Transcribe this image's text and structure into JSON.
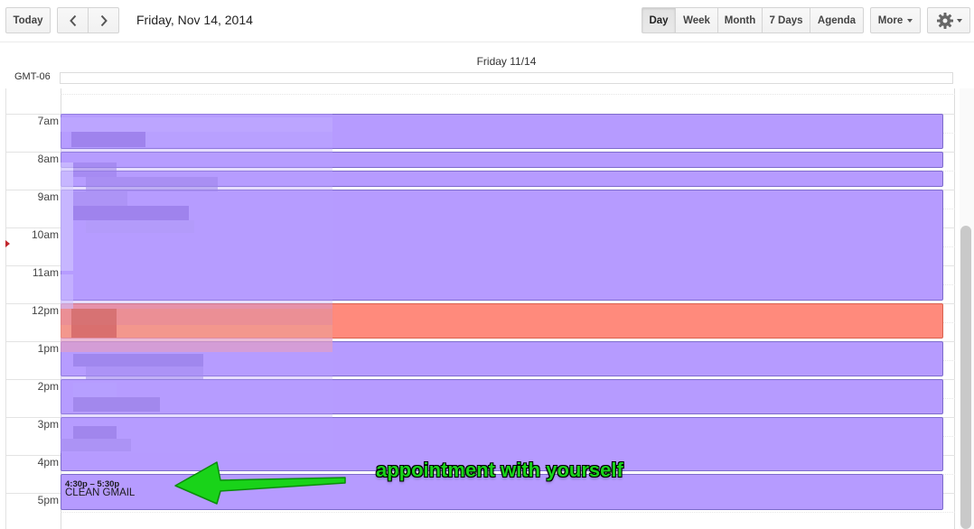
{
  "toolbar": {
    "today": "Today",
    "date_title": "Friday, Nov 14, 2014",
    "views": [
      "Day",
      "Week",
      "Month",
      "7 Days",
      "Agenda"
    ],
    "active_view": "Day",
    "more": "More",
    "icons": {
      "prev": "chevron-left-icon",
      "next": "chevron-right-icon",
      "settings": "gear-icon"
    }
  },
  "day_header": "Friday 11/14",
  "timezone": "GMT-06",
  "hours": [
    "7am",
    "8am",
    "9am",
    "10am",
    "11am",
    "12pm",
    "1pm",
    "2pm",
    "3pm",
    "4pm",
    "5pm"
  ],
  "events": [
    {
      "time": "4:30p – 5:30p",
      "title": "CLEAN GMAIL"
    }
  ],
  "annotation": "appointment with yourself",
  "colors": {
    "event_purple": "#b69bff",
    "event_red": "#ff8a7c",
    "annotation_green": "#19d319"
  }
}
